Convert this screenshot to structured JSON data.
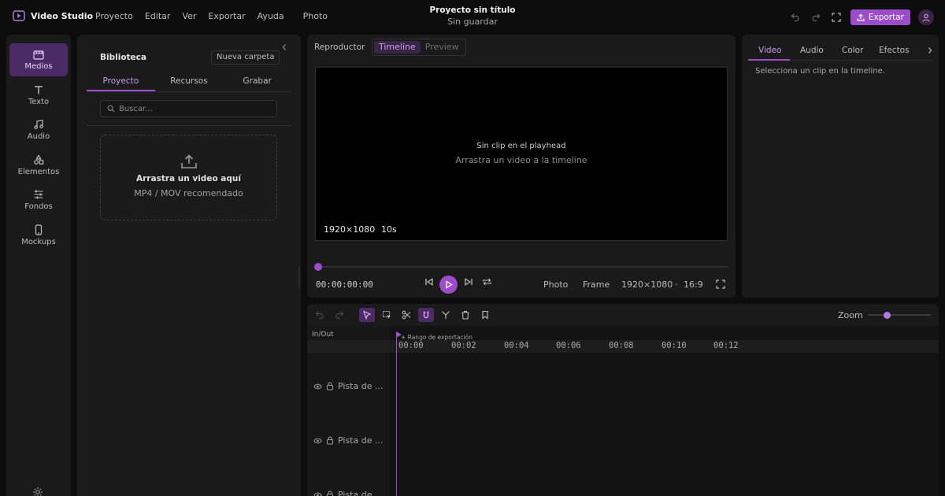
{
  "app": {
    "name": "Video Studio",
    "menu": [
      "Proyecto",
      "Editar",
      "Ver",
      "Exportar",
      "Ayuda"
    ],
    "menu_extra": "Photo",
    "project_title": "Proyecto sin título",
    "project_status": "Sin guardar",
    "export_label": "Exportar",
    "accent": "#9b4dcc"
  },
  "rail": {
    "items": [
      {
        "label": "Medios",
        "icon": "media-icon"
      },
      {
        "label": "Texto",
        "icon": "text-icon"
      },
      {
        "label": "Audio",
        "icon": "music-note-icon"
      },
      {
        "label": "Elementos",
        "icon": "shapes-icon"
      },
      {
        "label": "Fondos",
        "icon": "sliders-icon"
      },
      {
        "label": "Mockups",
        "icon": "phone-icon"
      }
    ]
  },
  "library": {
    "title": "Biblioteca",
    "new_folder": "Nueva carpeta",
    "tabs": [
      "Proyecto",
      "Recursos",
      "Grabar"
    ],
    "search_placeholder": "Buscar...",
    "drop_title": "Arrastra un video aquí",
    "drop_sub": "MP4 / MOV recomendado"
  },
  "player": {
    "label": "Reproductor",
    "modes": [
      "Timeline",
      "Preview"
    ],
    "empty_title": "Sin clip en el playhead",
    "empty_sub": "Arrastra un video a la timeline",
    "resolution": "1920×1080",
    "duration": "10s",
    "timecode": "00:00:00:00",
    "photo": "Photo",
    "frame": "Frame",
    "out_resolution": "1920×1080",
    "dot": "·",
    "aspect": "16:9"
  },
  "properties": {
    "tabs": [
      "Video",
      "Audio",
      "Color",
      "Efectos"
    ],
    "message": "Selecciona un clip en la timeline."
  },
  "timeline": {
    "zoom_label": "Zoom",
    "zoom_value": 0.3,
    "inout": "In/Out",
    "range_label": "Rango de exportación",
    "ticks": [
      "00:00",
      "00:02",
      "00:04",
      "00:06",
      "00:08",
      "00:10",
      "00:12"
    ],
    "tracks": [
      "Pista de ...",
      "Pista de ...",
      "Pista de ..."
    ]
  }
}
